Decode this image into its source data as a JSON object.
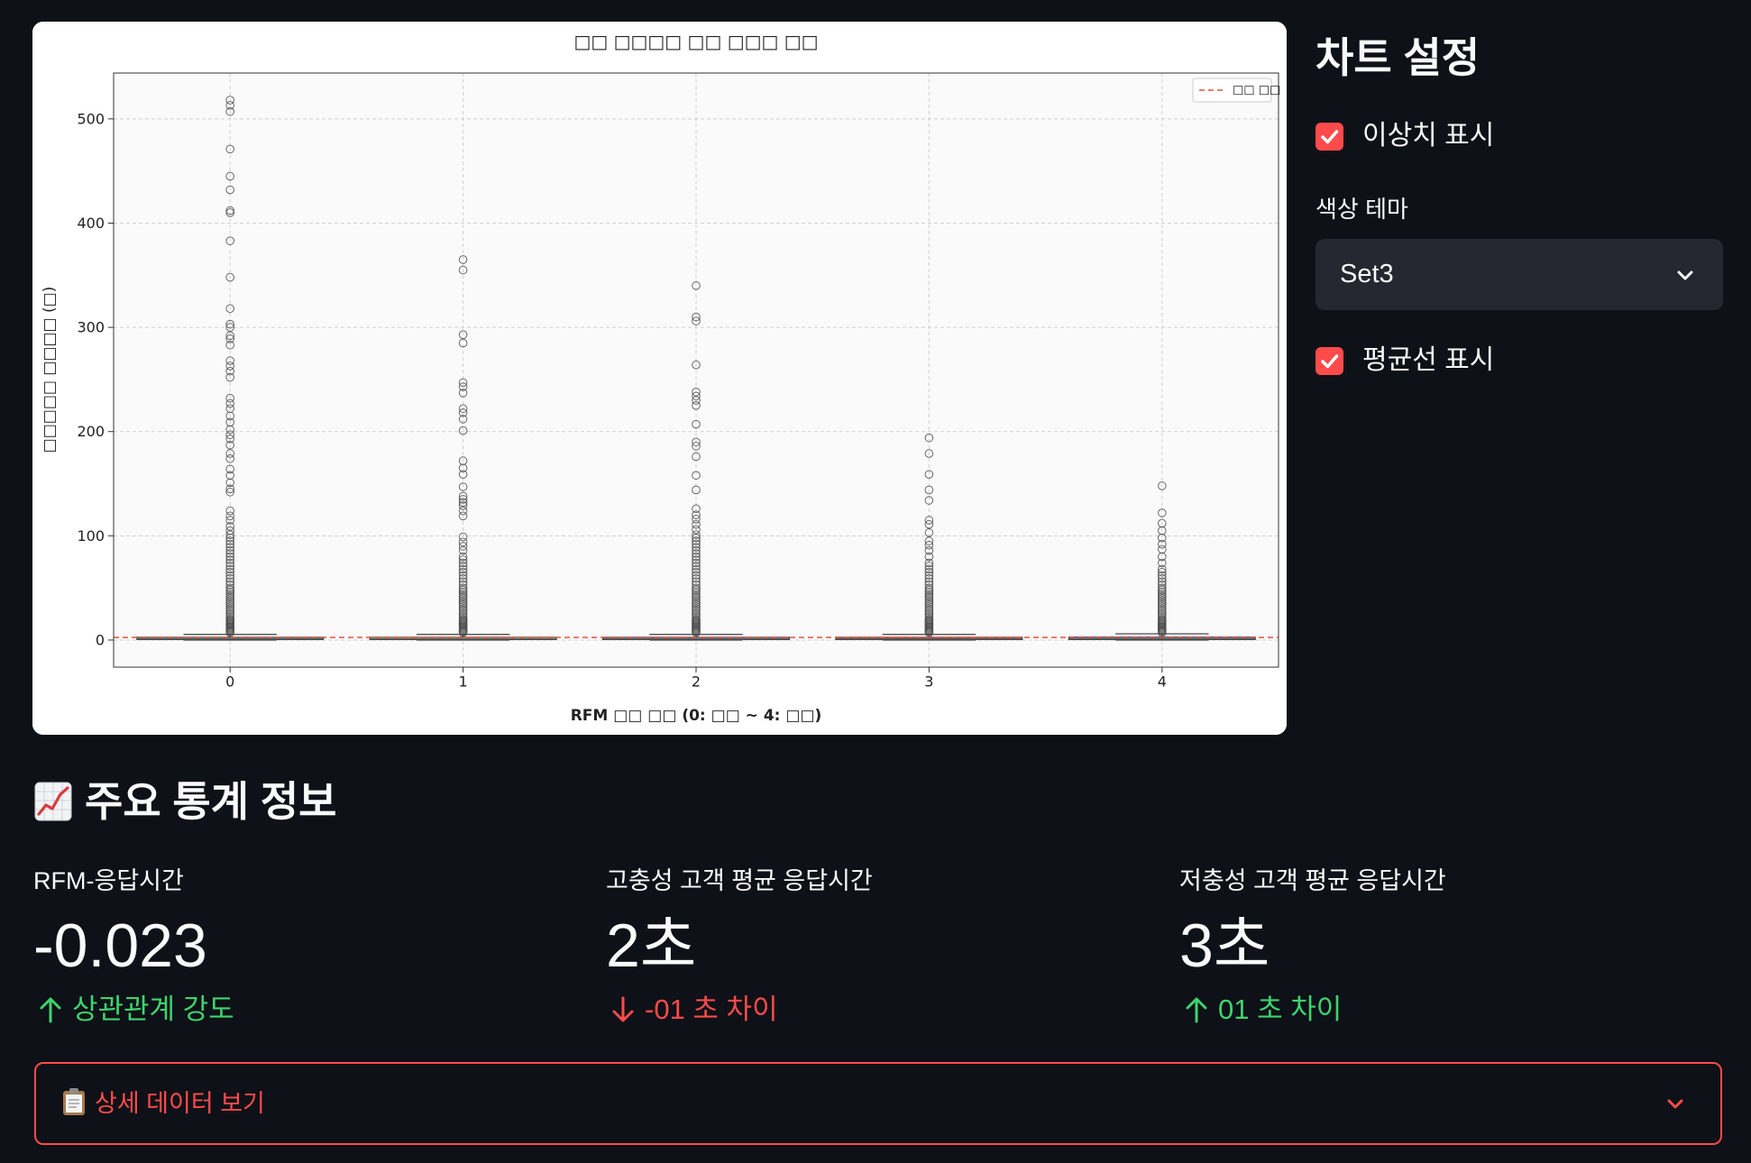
{
  "theme": {
    "background": "#0e1117",
    "text": "#fafafa",
    "accent": "#ff4b4b",
    "select_background": "#262730",
    "delta_up": "#3dd56d",
    "delta_down": "#ff4b4b"
  },
  "sidebar": {
    "title": "차트 설정",
    "show_outliers": {
      "label": "이상치 표시",
      "checked": true
    },
    "color_theme": {
      "label": "색상 테마",
      "value": "Set3",
      "icon": "chevron-down-icon"
    },
    "show_mean_line": {
      "label": "평균선 표시",
      "checked": true
    }
  },
  "stats": {
    "heading": "주요 통계 정보",
    "heading_icon": "chart-increasing-icon",
    "metrics": [
      {
        "label": "RFM-응답시간",
        "value": "-0.023",
        "delta": "상관관계 강도",
        "arrow_icon": "arrow-up-icon",
        "color": "#3dd56d"
      },
      {
        "label": "고충성 고객 평균 응답시간",
        "value": "2초",
        "delta": "-01 초 차이",
        "arrow_icon": "arrow-down-icon",
        "color": "#ff4b4b"
      },
      {
        "label": "저충성 고객 평균 응답시간",
        "value": "3초",
        "delta": "01 초 차이",
        "arrow_icon": "arrow-up-icon",
        "color": "#3dd56d"
      }
    ]
  },
  "details": {
    "label": "상세 데이터 보기",
    "icon": "clipboard-icon",
    "chevron_icon": "chevron-down-icon",
    "expanded": false
  },
  "chart_data": {
    "type": "box",
    "title": "□□ □□□□ □□ □□□ □□",
    "xlabel": "RFM □□ □□ (0: □□ ~ 4: □□)",
    "ylabel": "□□□□□ □□□□ (□)",
    "categories": [
      "0",
      "1",
      "2",
      "3",
      "4"
    ],
    "ylim": [
      -26,
      544
    ],
    "yticks": [
      0,
      100,
      200,
      300,
      400,
      500
    ],
    "grid": true,
    "box_colors": [
      "#8dd3c7",
      "#ffffb3",
      "#bebada",
      "#fb8072",
      "#80b1d3"
    ],
    "line_color": "#4d4d4d",
    "mean_line": {
      "value": 2.5,
      "color": "#e74c3c"
    },
    "legend": {
      "position": "top-right",
      "entries": [
        {
          "label": "□□ □□",
          "color": "#e74c3c"
        }
      ]
    },
    "boxes": [
      {
        "whisker_low": 0,
        "q1": 0.5,
        "median": 1,
        "q3": 2.6,
        "whisker_high": 5.4,
        "outliers": [
          7,
          8,
          9,
          10,
          11,
          12,
          13,
          14,
          15,
          16,
          17,
          18,
          19,
          20,
          22,
          24,
          26,
          28,
          30,
          32,
          34,
          36,
          38,
          40,
          42,
          44,
          46,
          48,
          50,
          53,
          56,
          59,
          62,
          65,
          68,
          71,
          74,
          77,
          80,
          83,
          86,
          89,
          92,
          95,
          98,
          101,
          105,
          109,
          115,
          119,
          124,
          142,
          145,
          151,
          158,
          164,
          174,
          179,
          187,
          193,
          197,
          202,
          209,
          215,
          222,
          227,
          232,
          252,
          258,
          263,
          268,
          283,
          289,
          292,
          300,
          303,
          318,
          348,
          383,
          410,
          412,
          432,
          445,
          471,
          507,
          513,
          518
        ]
      },
      {
        "whisker_low": 0,
        "q1": 0.5,
        "median": 1,
        "q3": 2.6,
        "whisker_high": 5.4,
        "outliers": [
          7,
          8,
          9,
          10,
          11,
          12,
          13,
          14,
          15,
          16,
          17,
          18,
          19,
          20,
          22,
          24,
          26,
          28,
          30,
          32,
          34,
          36,
          38,
          40,
          42,
          44,
          46,
          48,
          50,
          53,
          56,
          59,
          62,
          65,
          68,
          71,
          74,
          77,
          80,
          86,
          90,
          94,
          99,
          119,
          124,
          129,
          132,
          135,
          138,
          147,
          159,
          165,
          172,
          201,
          212,
          218,
          222,
          237,
          243,
          247,
          285,
          293,
          355,
          365
        ]
      },
      {
        "whisker_low": 0,
        "q1": 0.5,
        "median": 1,
        "q3": 2.6,
        "whisker_high": 5.4,
        "outliers": [
          7,
          8,
          9,
          10,
          11,
          12,
          13,
          14,
          15,
          16,
          17,
          18,
          19,
          20,
          22,
          24,
          26,
          28,
          30,
          32,
          34,
          36,
          38,
          40,
          42,
          44,
          46,
          48,
          50,
          53,
          56,
          59,
          62,
          65,
          68,
          71,
          74,
          77,
          80,
          83,
          86,
          89,
          92,
          95,
          98,
          101,
          106,
          111,
          116,
          120,
          126,
          144,
          158,
          176,
          186,
          190,
          207,
          225,
          230,
          234,
          238,
          264,
          306,
          310,
          340
        ]
      },
      {
        "whisker_low": 0,
        "q1": 0.5,
        "median": 1,
        "q3": 2.6,
        "whisker_high": 5.4,
        "outliers": [
          7,
          8,
          9,
          10,
          11,
          12,
          13,
          14,
          15,
          16,
          17,
          18,
          19,
          20,
          22,
          24,
          26,
          28,
          30,
          32,
          34,
          36,
          38,
          40,
          42,
          44,
          46,
          48,
          50,
          53,
          56,
          59,
          62,
          65,
          68,
          71,
          74,
          80,
          86,
          91,
          95,
          103,
          111,
          115,
          134,
          144,
          159,
          179,
          194
        ]
      },
      {
        "whisker_low": 0,
        "q1": 0.5,
        "median": 1,
        "q3": 2.8,
        "whisker_high": 6,
        "outliers": [
          7,
          8,
          9,
          10,
          11,
          12,
          13,
          14,
          15,
          16,
          17,
          18,
          19,
          20,
          22,
          24,
          26,
          28,
          30,
          32,
          34,
          36,
          38,
          40,
          42,
          44,
          46,
          48,
          50,
          53,
          56,
          59,
          62,
          65,
          68,
          74,
          80,
          87,
          92,
          98,
          105,
          112,
          122,
          148
        ]
      }
    ]
  }
}
